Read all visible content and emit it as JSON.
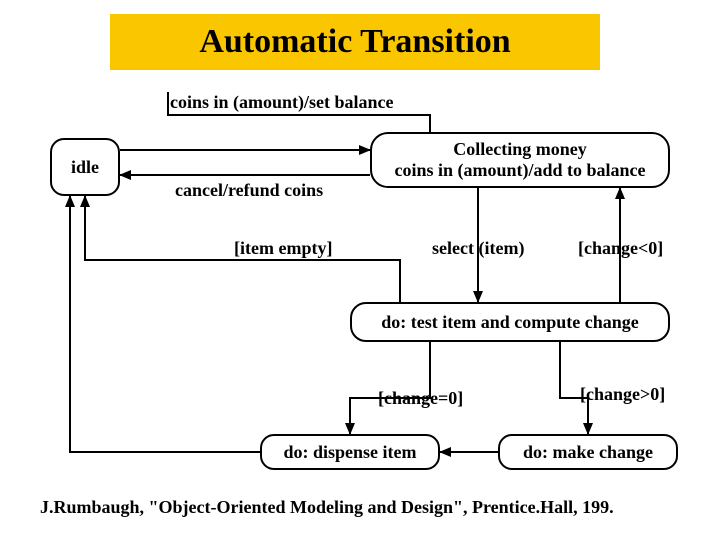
{
  "title": "Automatic Transition",
  "states": {
    "idle": "idle",
    "collecting_line1": "Collecting money",
    "collecting_line2": "coins in (amount)/add to balance",
    "test": "do: test item and compute change",
    "dispense": "do: dispense item",
    "make_change": "do: make change"
  },
  "labels": {
    "coins_in_set": "coins in (amount)/set balance",
    "cancel_refund": "cancel/refund coins",
    "item_empty": "[item empty]",
    "select_item": "select (item)",
    "change_lt0": "[change<0]",
    "change_eq0": "[change=0]",
    "change_gt0": "[change>0]"
  },
  "citation": "J.Rumbaugh, \"Object-Oriented Modeling and Design\", Prentice.Hall, 199."
}
